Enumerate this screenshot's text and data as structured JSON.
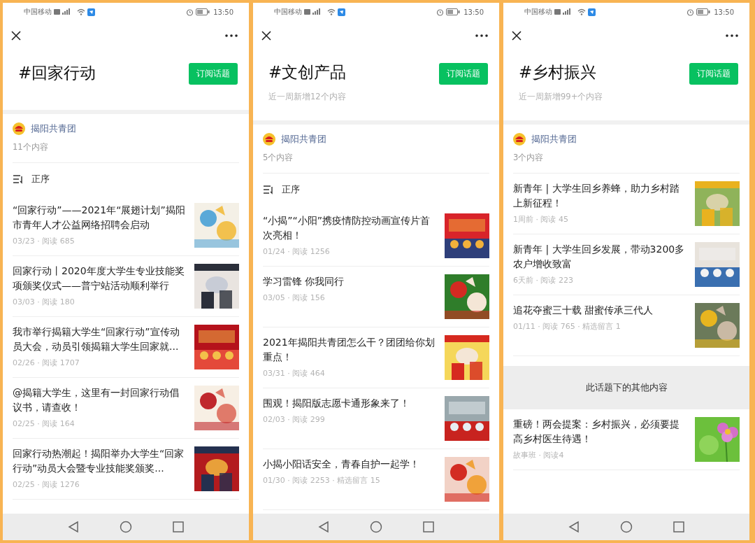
{
  "phones": [
    {
      "status_bar": {
        "carrier": "中国移动",
        "time": "13:50"
      },
      "topic": {
        "title": "#回家行动",
        "subscribe_button": "订阅话题"
      },
      "account": {
        "name": "揭阳共青团",
        "count": "11个内容"
      },
      "sort": {
        "label": "正序"
      },
      "articles": [
        {
          "title": "“回家行动”——2021年“展翅计划”揭阳市青年人才公益网络招聘会启动",
          "meta": "03/23 · 阅读 685"
        },
        {
          "title": "回家行动丨2020年度大学生专业技能奖项颁奖仪式——普宁站活动顺利举行",
          "meta": "03/03 · 阅读 180"
        },
        {
          "title": "我市举行揭籍大学生“回家行动”宣传动员大会，动员引领揭籍大学生回家就...",
          "meta": "02/26 · 阅读 1707"
        },
        {
          "title": "@揭籍大学生，这里有一封回家行动倡议书，请查收！",
          "meta": "02/25 · 阅读 164"
        },
        {
          "title": "回家行动热潮起！揭阳举办大学生“回家行动”动员大会暨专业技能奖颁奖...",
          "meta": "02/25 · 阅读 1276"
        }
      ]
    },
    {
      "status_bar": {
        "carrier": "中国移动",
        "time": "13:50"
      },
      "topic": {
        "title": "#文创产品",
        "subscribe_button": "订阅话题",
        "subtitle": "近一周新增12个内容"
      },
      "account": {
        "name": "揭阳共青团",
        "count": "5个内容"
      },
      "sort": {
        "label": "正序"
      },
      "articles": [
        {
          "title": "“小揭”“小阳”携疫情防控动画宣传片首次亮相！",
          "meta": "01/24 · 阅读 1256"
        },
        {
          "title": "学习雷锋 你我同行",
          "meta": "03/05 · 阅读 156"
        },
        {
          "title": "2021年揭阳共青团怎么干？团团给你划重点！",
          "meta": "03/31 · 阅读 464"
        },
        {
          "title": "围观！揭阳版志愿卡通形象来了！",
          "meta": "02/03 · 阅读 299"
        },
        {
          "title": "小揭小阳话安全，青春自护一起学！",
          "meta": "01/30 · 阅读 2253 · 精选留言 15"
        }
      ]
    },
    {
      "status_bar": {
        "carrier": "中国移动",
        "time": "13:50"
      },
      "topic": {
        "title": "#乡村振兴",
        "subscribe_button": "订阅话题",
        "subtitle": "近一周新增99+个内容"
      },
      "account": {
        "name": "揭阳共青团",
        "count": "3个内容"
      },
      "articles": [
        {
          "title": "新青年 | 大学生回乡养蜂，助力乡村踏上新征程！",
          "meta": "1周前 · 阅读 45"
        },
        {
          "title": "新青年 | 大学生回乡发展，带动3200多农户增收致富",
          "meta": "6天前 · 阅读 223"
        },
        {
          "title": "追花夺蜜三十载 甜蜜传承三代人",
          "meta": "01/11 · 阅读 765 · 精选留言 1"
        }
      ],
      "other_section": {
        "heading": "此话题下的其他内容",
        "articles": [
          {
            "title": "重磅！两会提案：乡村振兴，必须要提高乡村医生待遇！",
            "meta": "故事班 · 阅读4"
          }
        ]
      }
    }
  ]
}
